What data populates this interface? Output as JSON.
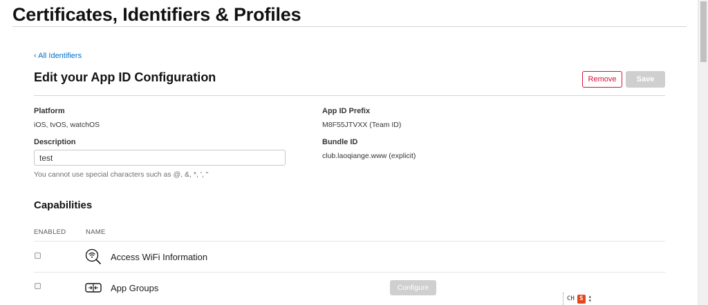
{
  "page": {
    "title": "Certificates, Identifiers & Profiles"
  },
  "nav": {
    "back_label": "‹ All Identifiers"
  },
  "header": {
    "title": "Edit your App ID Configuration",
    "remove_label": "Remove",
    "save_label": "Save"
  },
  "details": {
    "platform_label": "Platform",
    "platform_value": "iOS, tvOS, watchOS",
    "description_label": "Description",
    "description_value": "test",
    "description_hint": "You cannot use special characters such as @, &, *, ', \"",
    "prefix_label": "App ID Prefix",
    "prefix_value": "M8F55JTVXX (Team ID)",
    "bundle_label": "Bundle ID",
    "bundle_value": "club.laoqiange.www (explicit)"
  },
  "capabilities": {
    "title": "Capabilities",
    "col_enabled": "ENABLED",
    "col_name": "NAME",
    "items": [
      {
        "name": "Access WiFi Information",
        "icon": "wifi-search-icon",
        "enabled": false
      },
      {
        "name": "App Groups",
        "icon": "app-groups-icon",
        "enabled": false,
        "configure_label": "Configure"
      }
    ]
  },
  "ime": {
    "label": "CH",
    "icon_text": "S"
  },
  "colors": {
    "link": "#0070c9",
    "danger": "#d30f3a",
    "disabled": "#cfcfcf"
  }
}
